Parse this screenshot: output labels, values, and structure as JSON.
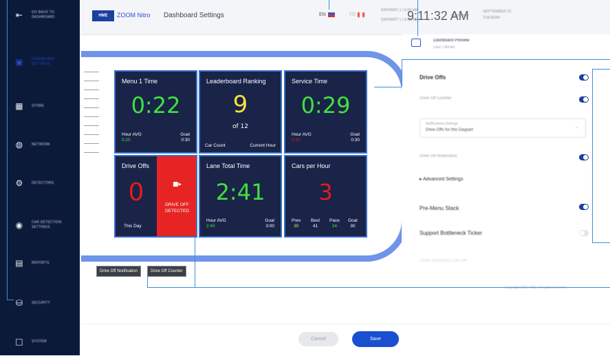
{
  "sidebar": {
    "items": [
      {
        "label": "GO BACK TO DASHBOARD",
        "icon": "back-arrow-icon"
      },
      {
        "label": "DASHBOARD SETTINGS",
        "icon": "dashboard-icon"
      },
      {
        "label": "STORE",
        "icon": "store-icon"
      },
      {
        "label": "NETWORK",
        "icon": "network-icon"
      },
      {
        "label": "DETECTORS",
        "icon": "gear-icon"
      },
      {
        "label": "CAR DETECTION SETTINGS",
        "icon": "car-detection-icon"
      },
      {
        "label": "REPORTS",
        "icon": "reports-icon"
      },
      {
        "label": "SECURITY",
        "icon": "lock-icon"
      },
      {
        "label": "SYSTEM",
        "icon": "monitor-icon"
      }
    ]
  },
  "header": {
    "logo": "HME",
    "app_name": "ZOOM Nitro",
    "page_title": "Dashboard Settings",
    "lang_en": "EN",
    "lang_fr": "FR",
    "daypart1": "DAYPART 1 | 5:00 AM",
    "daypart2": "DAYPART 1 | 5:00 AM",
    "shift": "SHIFT AM",
    "time": "9:11:32 AM",
    "date_line1": "SEPTEMBER 22",
    "date_line2": "TUESDAY"
  },
  "tiles": {
    "menu": {
      "title": "Menu 1 Time",
      "value": "0:22",
      "left_label": "Hour AVG",
      "left_value": "0:25",
      "right_label": "Goal",
      "right_value": "0:30"
    },
    "leaderboard": {
      "title": "Leaderboard Ranking",
      "value": "9",
      "of": "of 12",
      "left_label": "Car Count",
      "right_label": "Current Hour"
    },
    "service": {
      "title": "Service Time",
      "value": "0:29",
      "left_label": "Hour AVG",
      "left_value": "0:32",
      "right_label": "Goal",
      "right_value": "0:30"
    },
    "driveoffs": {
      "title": "Drive Offs",
      "value": "0",
      "sub": "This Day",
      "alert": "DRIVE OFF DETECTED"
    },
    "lane": {
      "title": "Lane Total Time",
      "value": "2:41",
      "left_label": "Hour AVG",
      "left_value": "2:45",
      "right_label": "Goal",
      "right_value": "3:00"
    },
    "cars": {
      "title": "Cars per Hour",
      "value": "3",
      "prev_label": "Prev",
      "prev": "30",
      "best_label": "Best",
      "best": "41",
      "pace_label": "Pace",
      "pace": "34",
      "goal_label": "Goal",
      "goal": "30"
    }
  },
  "tags": {
    "notification": "Drive Off Notification",
    "counter": "Drive Off Counter"
  },
  "panel": {
    "preview_title": "Dashboard Preview",
    "preview_sub": "Lane 1 Border",
    "drive_offs": "Drive Offs",
    "drive_off_counter": "Drive Off Counter",
    "select_label": "Notifications Settings",
    "select_value": "Drive Offs for this Daypart",
    "drive_off_notification": "Drive Off Notification",
    "advanced": "Advanced Settings",
    "pre_menu": "Pre-Menu Stack",
    "bottleneck": "Support Bottleneck Ticker",
    "faded1": "LANE BRANCH 1 ON OR",
    "faded2": "Copyright 2021 HME. All rights reserved."
  },
  "footer": {
    "cancel": "Cancel",
    "save": "Save"
  },
  "colors": {
    "sidebar": "#0c1a3a",
    "accent": "#1a4fd0",
    "tile_bg": "#1a2348",
    "green": "#3ee23e",
    "yellow": "#f3e23a",
    "red": "#e21c1c",
    "callout": "#3a8fd8"
  }
}
